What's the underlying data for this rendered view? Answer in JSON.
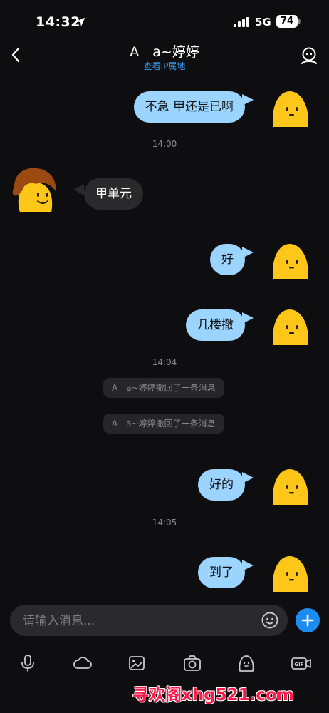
{
  "status_bar": {
    "time": "14:32",
    "network": "5G",
    "battery": "74"
  },
  "header": {
    "title": "A　a~婷婷",
    "subtitle": "查看IP属地"
  },
  "messages": [
    {
      "type": "out",
      "text": "不急 甲还是已啊"
    },
    {
      "type": "time",
      "text": "14:00"
    },
    {
      "type": "in",
      "text": "甲单元"
    },
    {
      "type": "out",
      "text": "好"
    },
    {
      "type": "out",
      "text": "几楼撤"
    },
    {
      "type": "time",
      "text": "14:04"
    },
    {
      "type": "notice",
      "text": "A　a~婷婷撤回了一条消息"
    },
    {
      "type": "notice",
      "text": "A　a~婷婷撤回了一条消息"
    },
    {
      "type": "out",
      "text": "好的"
    },
    {
      "type": "time",
      "text": "14:05"
    },
    {
      "type": "out",
      "text": "到了"
    }
  ],
  "input": {
    "placeholder": "请输入消息..."
  },
  "toolbar_icons": [
    "microphone-icon",
    "cloud-icon",
    "image-icon",
    "camera-icon",
    "sticker-icon",
    "gif-icon"
  ],
  "watermark": "寻欢阁xhg521.com",
  "colors": {
    "background": "#0e0e10",
    "outgoing_bubble": "#9ad4ff",
    "incoming_bubble": "#2a2a2d",
    "accent": "#1d8cf0",
    "avatar_yellow": "#ffc61a"
  }
}
